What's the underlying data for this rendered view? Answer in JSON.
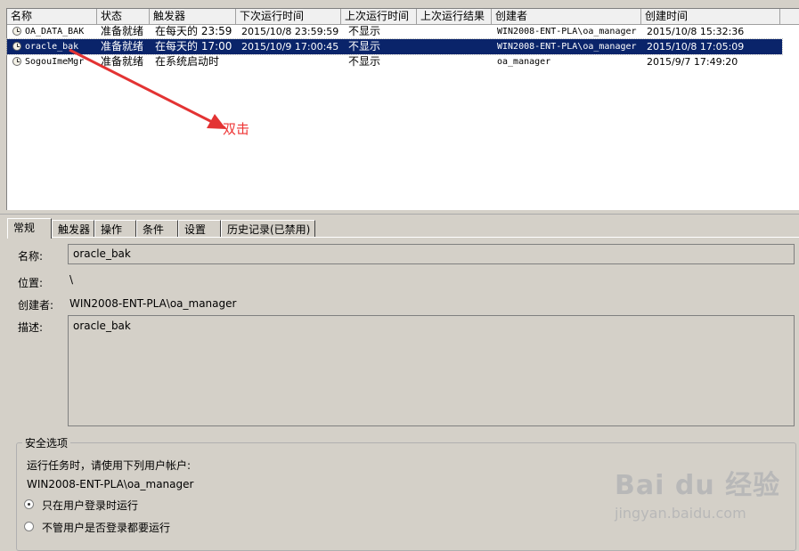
{
  "columns": [
    "名称",
    "状态",
    "触发器",
    "下次运行时间",
    "上次运行时间",
    "上次运行结果",
    "创建者",
    "创建时间"
  ],
  "tasks": [
    {
      "name": "OA_DATA_BAK",
      "status": "准备就绪",
      "trigger": "在每天的 23:59",
      "next_run": "2015/10/8 23:59:59",
      "last_run": "不显示",
      "last_result": "",
      "author": "WIN2008-ENT-PLA\\oa_manager",
      "created": "2015/10/8 15:32:36"
    },
    {
      "name": "oracle_bak",
      "status": "准备就绪",
      "trigger": "在每天的 17:00",
      "next_run": "2015/10/9 17:00:45",
      "last_run": "不显示",
      "last_result": "",
      "author": "WIN2008-ENT-PLA\\oa_manager",
      "created": "2015/10/8 17:05:09"
    },
    {
      "name": "SogouImeMgr",
      "status": "准备就绪",
      "trigger": "在系统启动时",
      "next_run": "",
      "last_run": "不显示",
      "last_result": "",
      "author": "oa_manager",
      "created": "2015/9/7 17:49:20"
    }
  ],
  "annotation": "双击",
  "tabs": [
    "常规",
    "触发器",
    "操作",
    "条件",
    "设置",
    "历史记录(已禁用)"
  ],
  "general": {
    "name_label": "名称:",
    "name_value": "oracle_bak",
    "location_label": "位置:",
    "location_value": "\\",
    "author_label": "创建者:",
    "author_value": "WIN2008-ENT-PLA\\oa_manager",
    "desc_label": "描述:",
    "desc_value": "oracle_bak"
  },
  "security": {
    "title": "安全选项",
    "run_as_prompt": "运行任务时，请使用下列用户帐户:",
    "account": "WIN2008-ENT-PLA\\oa_manager",
    "option1": "只在用户登录时运行",
    "option2": "不管用户是否登录都要运行"
  },
  "watermark": {
    "logo": "Bai du 经验",
    "url": "jingyan.baidu.com"
  },
  "colors": {
    "selection": "#0a246a",
    "annotation": "#e33333",
    "background": "#d4d0c8"
  }
}
